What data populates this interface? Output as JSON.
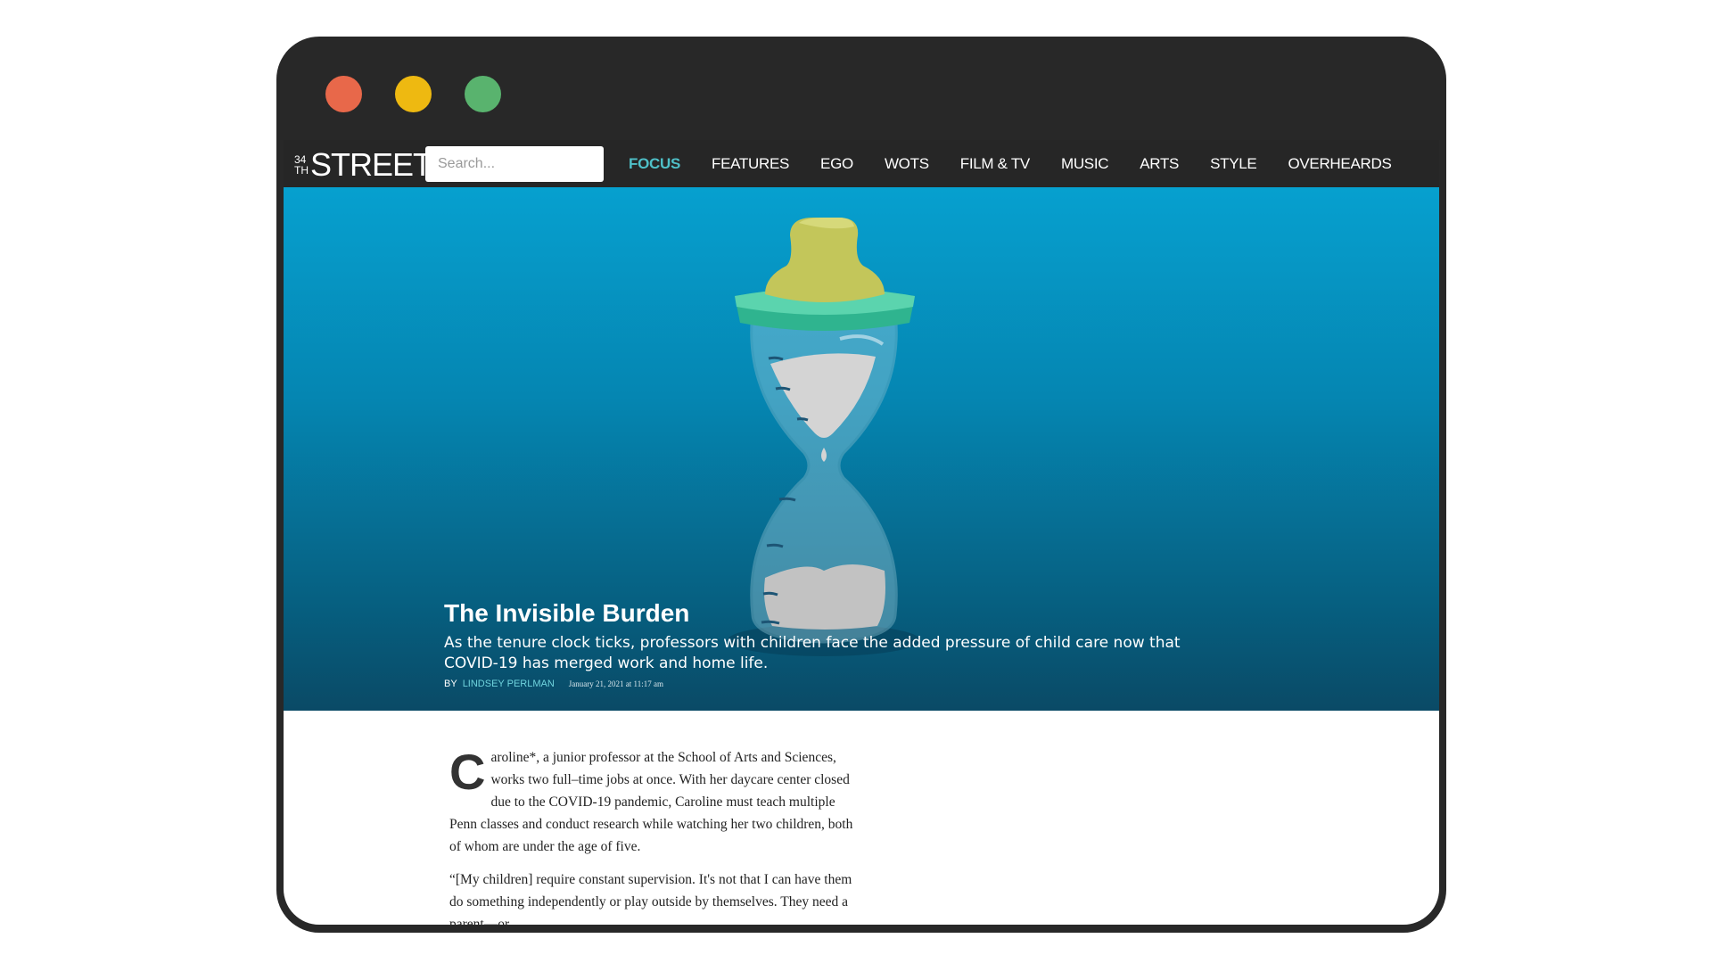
{
  "window": {
    "controls": [
      {
        "name": "close",
        "color": "#e8684a"
      },
      {
        "name": "minimize",
        "color": "#eeb911"
      },
      {
        "name": "maximize",
        "color": "#59b36e"
      }
    ]
  },
  "header": {
    "logo": {
      "prefix_top": "34",
      "prefix_bottom": "TH",
      "main": "STREET"
    },
    "search": {
      "placeholder": "Search..."
    },
    "nav": [
      {
        "label": "FOCUS",
        "active": true
      },
      {
        "label": "FEATURES",
        "active": false
      },
      {
        "label": "EGO",
        "active": false
      },
      {
        "label": "WOTS",
        "active": false
      },
      {
        "label": "FILM & TV",
        "active": false
      },
      {
        "label": "MUSIC",
        "active": false
      },
      {
        "label": "ARTS",
        "active": false
      },
      {
        "label": "STYLE",
        "active": false
      },
      {
        "label": "OVERHEARDS",
        "active": false
      }
    ]
  },
  "hero": {
    "image": "hourglass-baby-bottle-illustration",
    "title": "The Invisible Burden",
    "subtitle": "As the tenure clock ticks, professors with children face the added pressure of child care now that COVID-19 has merged work and home life.",
    "byline_prefix": "BY",
    "author": "LINDSEY PERLMAN",
    "date": "January 21, 2021 at 11:17 am"
  },
  "article": {
    "dropcap": "C",
    "paragraphs": [
      "aroline*, a junior professor at the School of Arts and Sciences, works two full–time jobs at once. With her daycare center closed due to the COVID-19 pandemic, Caroline must teach multiple Penn classes and conduct research while watching her two children, both of whom are under the age of five.",
      "“[My children] require constant supervision. It's not that I can have them do something independently or play outside by themselves. They need a parent—or"
    ]
  },
  "colors": {
    "accent": "#4fc0c8",
    "nav_bg": "#262626",
    "frame": "#282828"
  }
}
